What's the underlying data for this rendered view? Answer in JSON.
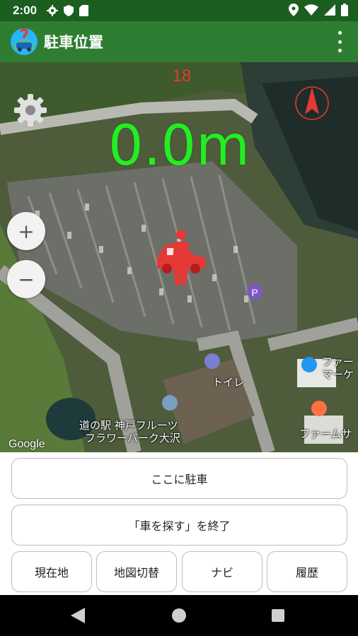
{
  "status_bar": {
    "time": "2:00",
    "left_icons": [
      "gear-icon",
      "shield-icon",
      "sd-card-icon"
    ],
    "right_icons": [
      "location-icon",
      "wifi-icon",
      "signal-icon",
      "battery-icon"
    ]
  },
  "app_bar": {
    "title": "駐車位置",
    "menu_icon": "more-vert-icon"
  },
  "map": {
    "distance": "0.0m",
    "accuracy": "18",
    "attribution": "Google",
    "poi": {
      "station_line1": "道の駅 神戸フルーツ",
      "station_line2": "フラワーパーク大沢",
      "toilet": "トイレ",
      "market_line1": "ファー",
      "market_line2": "マーケ",
      "farm": "ファームサ"
    },
    "zoom_in": "+",
    "zoom_out": "−",
    "colors": {
      "distance": "#22ee22",
      "compass": "#e53935",
      "car_marker": "#e53935"
    }
  },
  "controls": {
    "park_here": "ここに駐車",
    "end_search": "「車を探す」を終了",
    "current_location": "現在地",
    "switch_map": "地図切替",
    "navigate": "ナビ",
    "history": "履歴"
  },
  "nav_bar": {
    "icons": [
      "back-icon",
      "home-icon",
      "recents-icon"
    ]
  },
  "theme": {
    "primary": "#2e7d32",
    "status_bar": "#1b5e20"
  }
}
